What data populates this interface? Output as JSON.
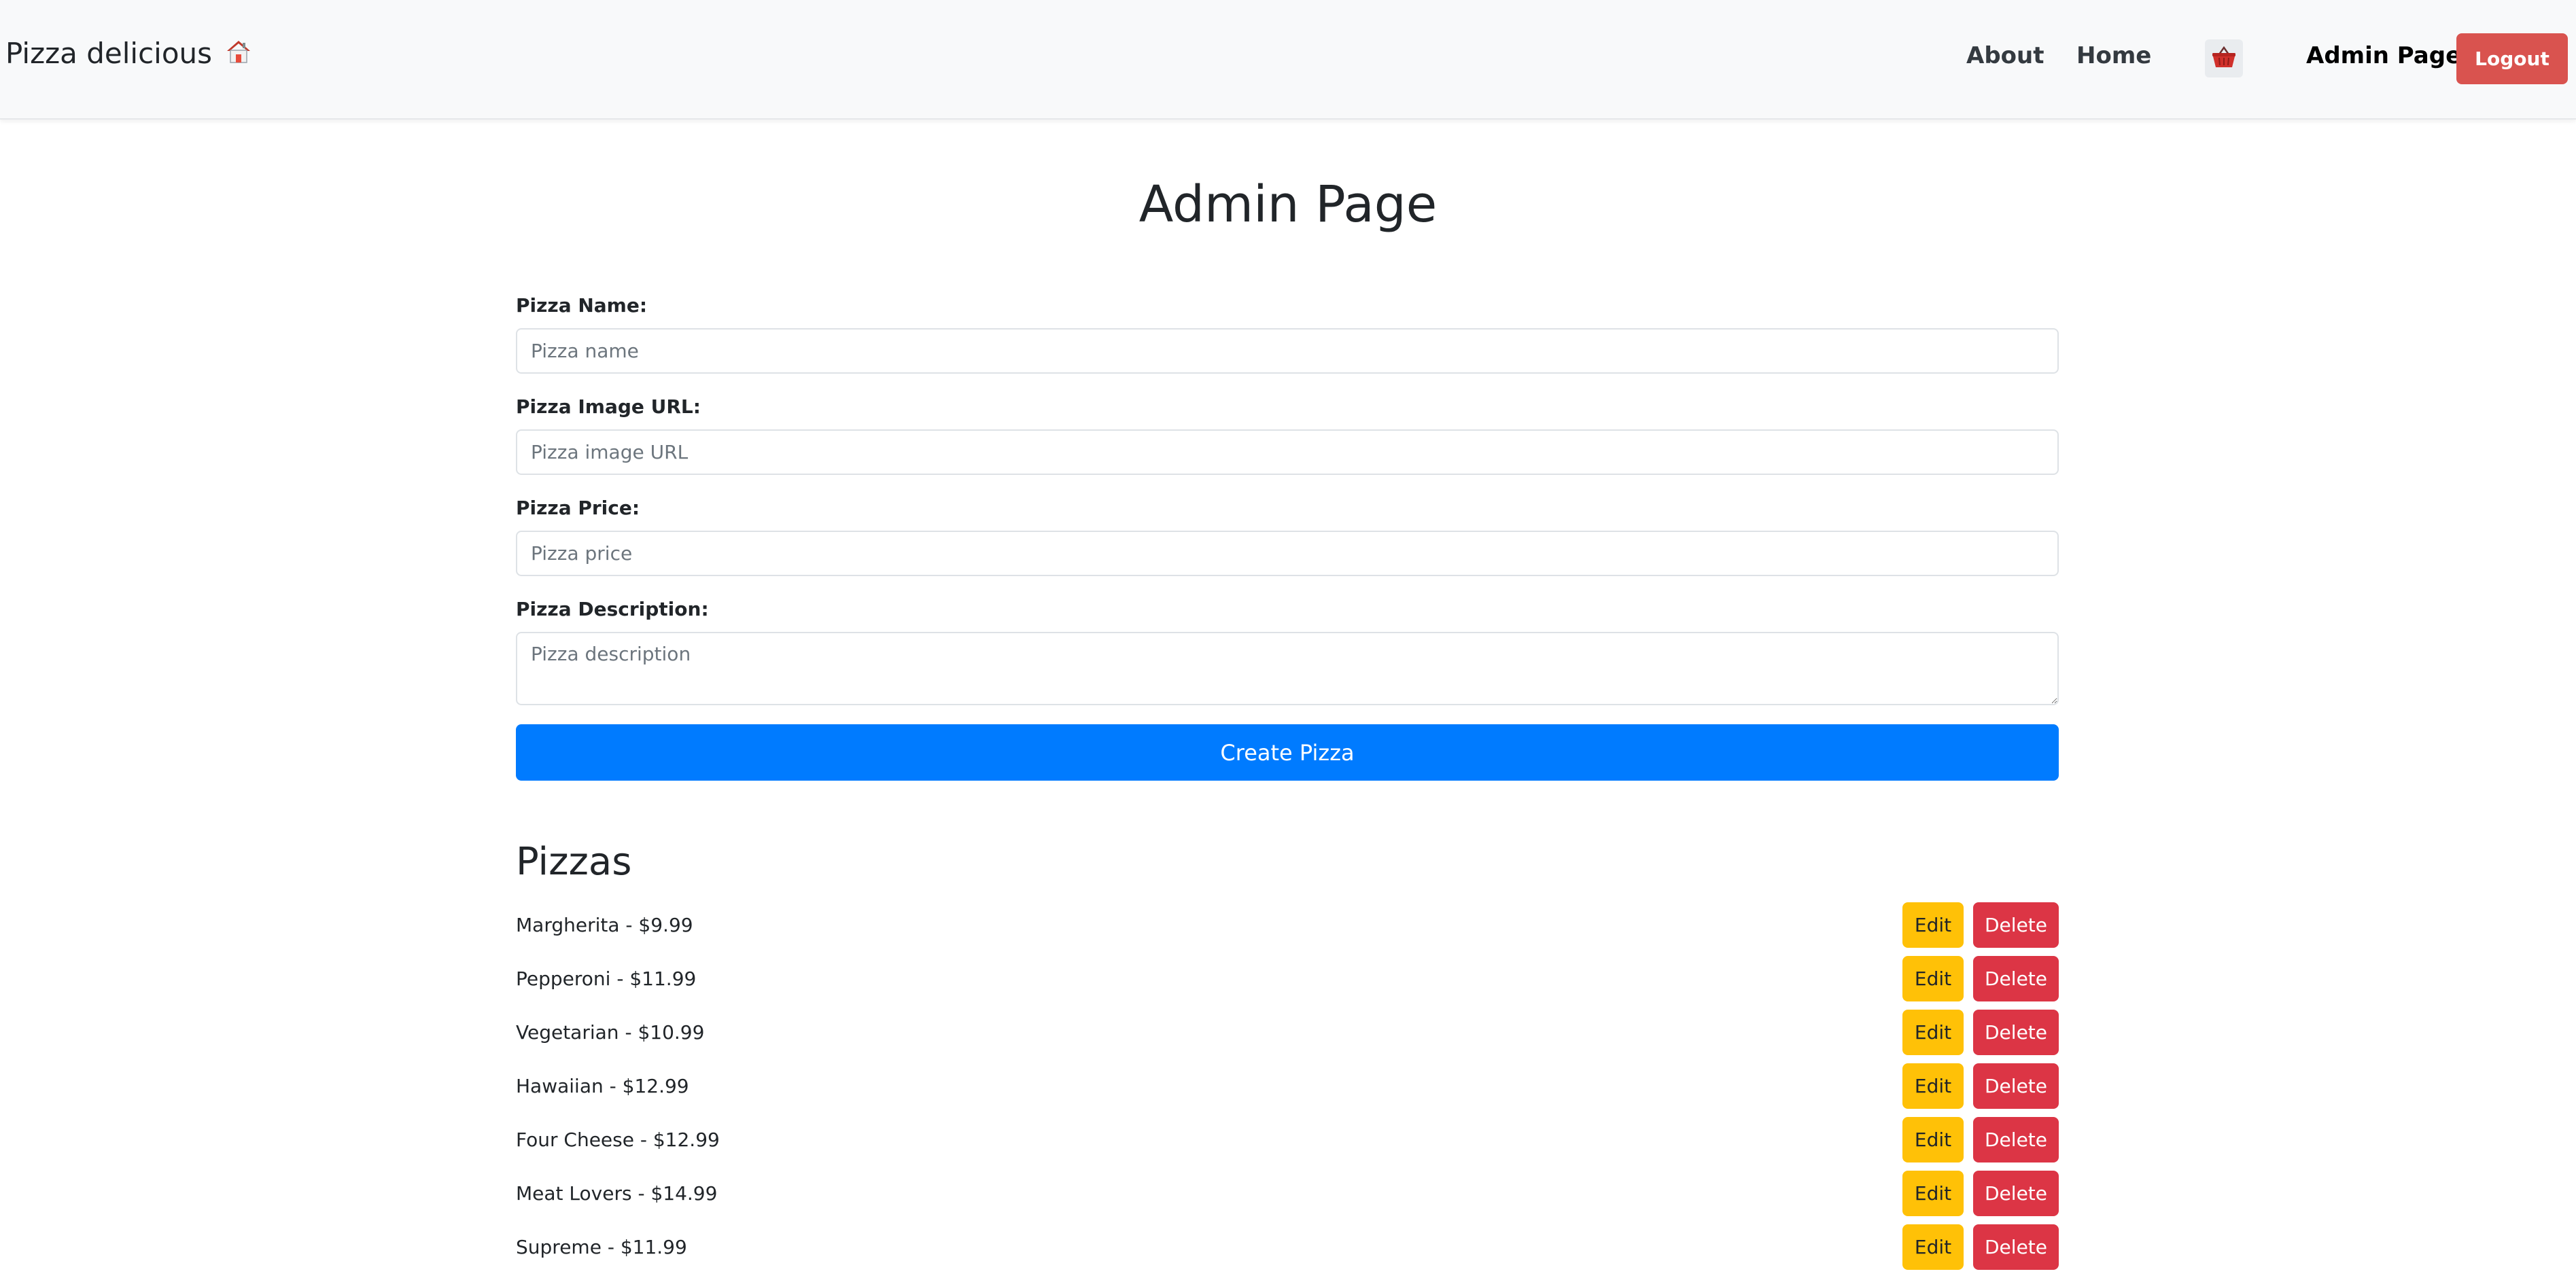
{
  "navbar": {
    "brand": "Pizza delicious",
    "brand_icon": "home-icon",
    "links": {
      "about": "About",
      "home": "Home",
      "admin": "Admin Page"
    },
    "cart_icon": "basket-icon",
    "logout_label": "Logout"
  },
  "main": {
    "title": "Admin Page",
    "form": {
      "name_label": "Pizza Name:",
      "name_placeholder": "Pizza name",
      "image_label": "Pizza Image URL:",
      "image_placeholder": "Pizza image URL",
      "price_label": "Pizza Price:",
      "price_placeholder": "Pizza price",
      "description_label": "Pizza Description:",
      "description_placeholder": "Pizza description",
      "submit_label": "Create Pizza"
    },
    "pizzas_heading": "Pizzas",
    "edit_label": "Edit",
    "delete_label": "Delete",
    "pizzas": [
      "Margherita - $9.99",
      "Pepperoni - $11.99",
      "Vegetarian - $10.99",
      "Hawaiian - $12.99",
      "Four Cheese - $12.99",
      "Meat Lovers - $14.99",
      "Supreme - $11.99"
    ]
  },
  "colors": {
    "navbar_bg": "#f8f9fa",
    "primary": "#007bff",
    "warning": "#ffc107",
    "danger": "#dc3545",
    "logout": "#d9534f"
  }
}
